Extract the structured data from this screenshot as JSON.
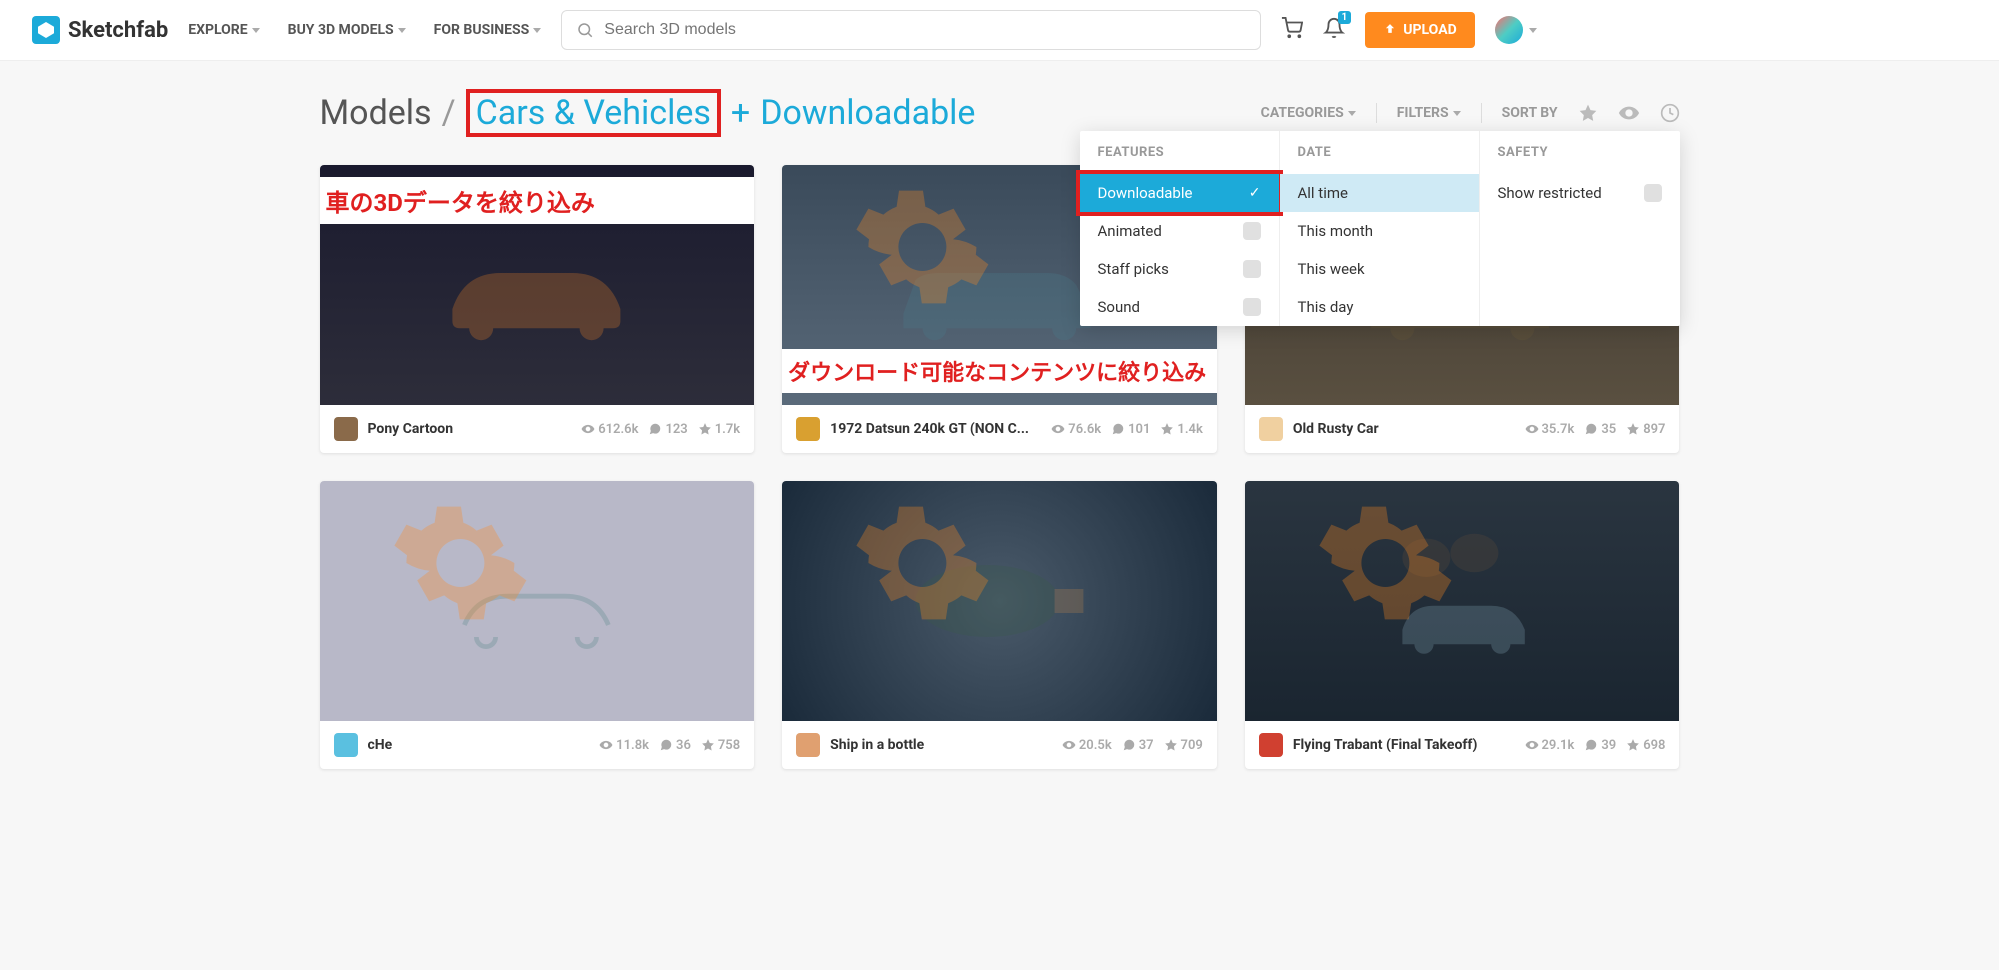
{
  "header": {
    "brand": "Sketchfab",
    "nav": [
      {
        "label": "EXPLORE"
      },
      {
        "label": "BUY 3D MODELS"
      },
      {
        "label": "FOR BUSINESS"
      }
    ],
    "search_placeholder": "Search 3D models",
    "notification_badge": "1",
    "upload_label": "UPLOAD"
  },
  "title": {
    "base": "Models",
    "slash": "/",
    "category": "Cars & Vehicles",
    "plus": "+",
    "filter": "Downloadable"
  },
  "sort": {
    "categories": "CATEGORIES",
    "filters": "FILTERS",
    "sort_by": "SORT BY"
  },
  "filter_dropdown": {
    "features": {
      "header": "FEATURES",
      "options": [
        {
          "label": "Downloadable",
          "selected": true
        },
        {
          "label": "Animated",
          "selected": false
        },
        {
          "label": "Staff picks",
          "selected": false
        },
        {
          "label": "Sound",
          "selected": false
        }
      ]
    },
    "date": {
      "header": "DATE",
      "options": [
        {
          "label": "All time",
          "selected": true
        },
        {
          "label": "This month",
          "selected": false
        },
        {
          "label": "This week",
          "selected": false
        },
        {
          "label": "This day",
          "selected": false
        }
      ]
    },
    "safety": {
      "header": "SAFETY",
      "options": [
        {
          "label": "Show restricted",
          "selected": false
        }
      ]
    }
  },
  "annotations": {
    "card1": "車の3Dデータを絞り込み",
    "card2": "ダウンロード可能なコンテンツに絞り込み"
  },
  "cards": [
    {
      "title": "Pony Cartoon",
      "views": "612.6k",
      "comments": "123",
      "likes": "1.7k"
    },
    {
      "title": "1972 Datsun 240k GT (NON C...",
      "views": "76.6k",
      "comments": "101",
      "likes": "1.4k"
    },
    {
      "title": "Old Rusty Car",
      "views": "35.7k",
      "comments": "35",
      "likes": "897"
    },
    {
      "title": "cHe",
      "views": "11.8k",
      "comments": "36",
      "likes": "758"
    },
    {
      "title": "Ship in a bottle",
      "views": "20.5k",
      "comments": "37",
      "likes": "709"
    },
    {
      "title": "Flying Trabant (Final Takeoff)",
      "views": "29.1k",
      "comments": "39",
      "likes": "698"
    }
  ]
}
